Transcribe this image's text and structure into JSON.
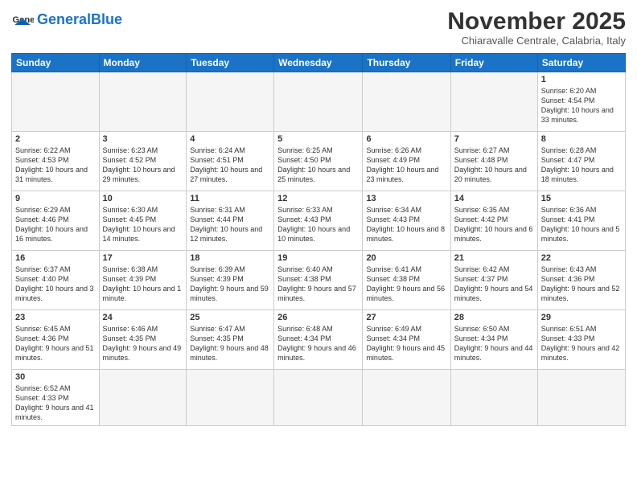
{
  "logo": {
    "general": "General",
    "blue": "Blue"
  },
  "title": "November 2025",
  "location": "Chiaravalle Centrale, Calabria, Italy",
  "weekdays": [
    "Sunday",
    "Monday",
    "Tuesday",
    "Wednesday",
    "Thursday",
    "Friday",
    "Saturday"
  ],
  "weeks": [
    [
      {
        "day": "",
        "info": ""
      },
      {
        "day": "",
        "info": ""
      },
      {
        "day": "",
        "info": ""
      },
      {
        "day": "",
        "info": ""
      },
      {
        "day": "",
        "info": ""
      },
      {
        "day": "",
        "info": ""
      },
      {
        "day": "1",
        "info": "Sunrise: 6:20 AM\nSunset: 4:54 PM\nDaylight: 10 hours and 33 minutes."
      }
    ],
    [
      {
        "day": "2",
        "info": "Sunrise: 6:22 AM\nSunset: 4:53 PM\nDaylight: 10 hours and 31 minutes."
      },
      {
        "day": "3",
        "info": "Sunrise: 6:23 AM\nSunset: 4:52 PM\nDaylight: 10 hours and 29 minutes."
      },
      {
        "day": "4",
        "info": "Sunrise: 6:24 AM\nSunset: 4:51 PM\nDaylight: 10 hours and 27 minutes."
      },
      {
        "day": "5",
        "info": "Sunrise: 6:25 AM\nSunset: 4:50 PM\nDaylight: 10 hours and 25 minutes."
      },
      {
        "day": "6",
        "info": "Sunrise: 6:26 AM\nSunset: 4:49 PM\nDaylight: 10 hours and 23 minutes."
      },
      {
        "day": "7",
        "info": "Sunrise: 6:27 AM\nSunset: 4:48 PM\nDaylight: 10 hours and 20 minutes."
      },
      {
        "day": "8",
        "info": "Sunrise: 6:28 AM\nSunset: 4:47 PM\nDaylight: 10 hours and 18 minutes."
      }
    ],
    [
      {
        "day": "9",
        "info": "Sunrise: 6:29 AM\nSunset: 4:46 PM\nDaylight: 10 hours and 16 minutes."
      },
      {
        "day": "10",
        "info": "Sunrise: 6:30 AM\nSunset: 4:45 PM\nDaylight: 10 hours and 14 minutes."
      },
      {
        "day": "11",
        "info": "Sunrise: 6:31 AM\nSunset: 4:44 PM\nDaylight: 10 hours and 12 minutes."
      },
      {
        "day": "12",
        "info": "Sunrise: 6:33 AM\nSunset: 4:43 PM\nDaylight: 10 hours and 10 minutes."
      },
      {
        "day": "13",
        "info": "Sunrise: 6:34 AM\nSunset: 4:43 PM\nDaylight: 10 hours and 8 minutes."
      },
      {
        "day": "14",
        "info": "Sunrise: 6:35 AM\nSunset: 4:42 PM\nDaylight: 10 hours and 6 minutes."
      },
      {
        "day": "15",
        "info": "Sunrise: 6:36 AM\nSunset: 4:41 PM\nDaylight: 10 hours and 5 minutes."
      }
    ],
    [
      {
        "day": "16",
        "info": "Sunrise: 6:37 AM\nSunset: 4:40 PM\nDaylight: 10 hours and 3 minutes."
      },
      {
        "day": "17",
        "info": "Sunrise: 6:38 AM\nSunset: 4:39 PM\nDaylight: 10 hours and 1 minute."
      },
      {
        "day": "18",
        "info": "Sunrise: 6:39 AM\nSunset: 4:39 PM\nDaylight: 9 hours and 59 minutes."
      },
      {
        "day": "19",
        "info": "Sunrise: 6:40 AM\nSunset: 4:38 PM\nDaylight: 9 hours and 57 minutes."
      },
      {
        "day": "20",
        "info": "Sunrise: 6:41 AM\nSunset: 4:38 PM\nDaylight: 9 hours and 56 minutes."
      },
      {
        "day": "21",
        "info": "Sunrise: 6:42 AM\nSunset: 4:37 PM\nDaylight: 9 hours and 54 minutes."
      },
      {
        "day": "22",
        "info": "Sunrise: 6:43 AM\nSunset: 4:36 PM\nDaylight: 9 hours and 52 minutes."
      }
    ],
    [
      {
        "day": "23",
        "info": "Sunrise: 6:45 AM\nSunset: 4:36 PM\nDaylight: 9 hours and 51 minutes."
      },
      {
        "day": "24",
        "info": "Sunrise: 6:46 AM\nSunset: 4:35 PM\nDaylight: 9 hours and 49 minutes."
      },
      {
        "day": "25",
        "info": "Sunrise: 6:47 AM\nSunset: 4:35 PM\nDaylight: 9 hours and 48 minutes."
      },
      {
        "day": "26",
        "info": "Sunrise: 6:48 AM\nSunset: 4:34 PM\nDaylight: 9 hours and 46 minutes."
      },
      {
        "day": "27",
        "info": "Sunrise: 6:49 AM\nSunset: 4:34 PM\nDaylight: 9 hours and 45 minutes."
      },
      {
        "day": "28",
        "info": "Sunrise: 6:50 AM\nSunset: 4:34 PM\nDaylight: 9 hours and 44 minutes."
      },
      {
        "day": "29",
        "info": "Sunrise: 6:51 AM\nSunset: 4:33 PM\nDaylight: 9 hours and 42 minutes."
      }
    ],
    [
      {
        "day": "30",
        "info": "Sunrise: 6:52 AM\nSunset: 4:33 PM\nDaylight: 9 hours and 41 minutes."
      },
      {
        "day": "",
        "info": ""
      },
      {
        "day": "",
        "info": ""
      },
      {
        "day": "",
        "info": ""
      },
      {
        "day": "",
        "info": ""
      },
      {
        "day": "",
        "info": ""
      },
      {
        "day": "",
        "info": ""
      }
    ]
  ]
}
